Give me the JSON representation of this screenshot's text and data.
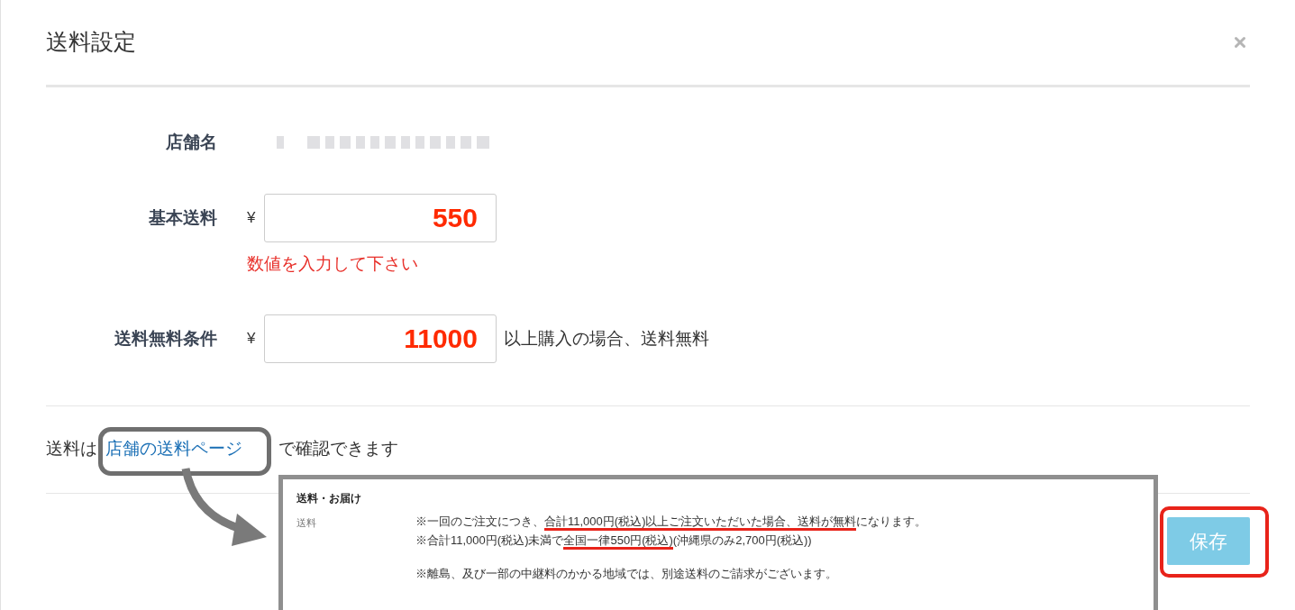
{
  "dialog": {
    "title": "送料設定"
  },
  "fields": [
    {
      "kind": "readonly",
      "label": "店舗名"
    },
    {
      "kind": "input",
      "label": "基本送料",
      "prefix": "¥",
      "value": "550",
      "error": "数値を入力して下さい"
    },
    {
      "kind": "input",
      "label": "送料無料条件",
      "prefix": "¥",
      "value": "11000",
      "suffix": "以上購入の場合、送料無料"
    }
  ],
  "note": {
    "before": "送料は",
    "link": "店舗の送料ページ",
    "after": "で確認できます"
  },
  "preview": {
    "heading": "送料・お届け",
    "label": "送料",
    "paragraphs": [
      [
        {
          "segments": [
            {
              "text": "※一回のご注文につき、",
              "underlined": false
            },
            {
              "text": "合計11,000円(税込)以上ご注文いただいた場合、送料が無料",
              "underlined": true
            },
            {
              "text": "になります。",
              "underlined": false
            }
          ]
        },
        {
          "segments": [
            {
              "text": "※合計11,000円(税込)未満で",
              "underlined": false
            },
            {
              "text": "全国一律550円(税込)",
              "underlined": true
            },
            {
              "text": "(沖縄県のみ2,700円(税込))",
              "underlined": false
            }
          ]
        }
      ],
      [
        {
          "segments": [
            {
              "text": "※離島、及び一部の中継料のかかる地域では、別途送料のご請求がございます。",
              "underlined": false
            }
          ]
        }
      ]
    ]
  },
  "save_button": "保存"
}
